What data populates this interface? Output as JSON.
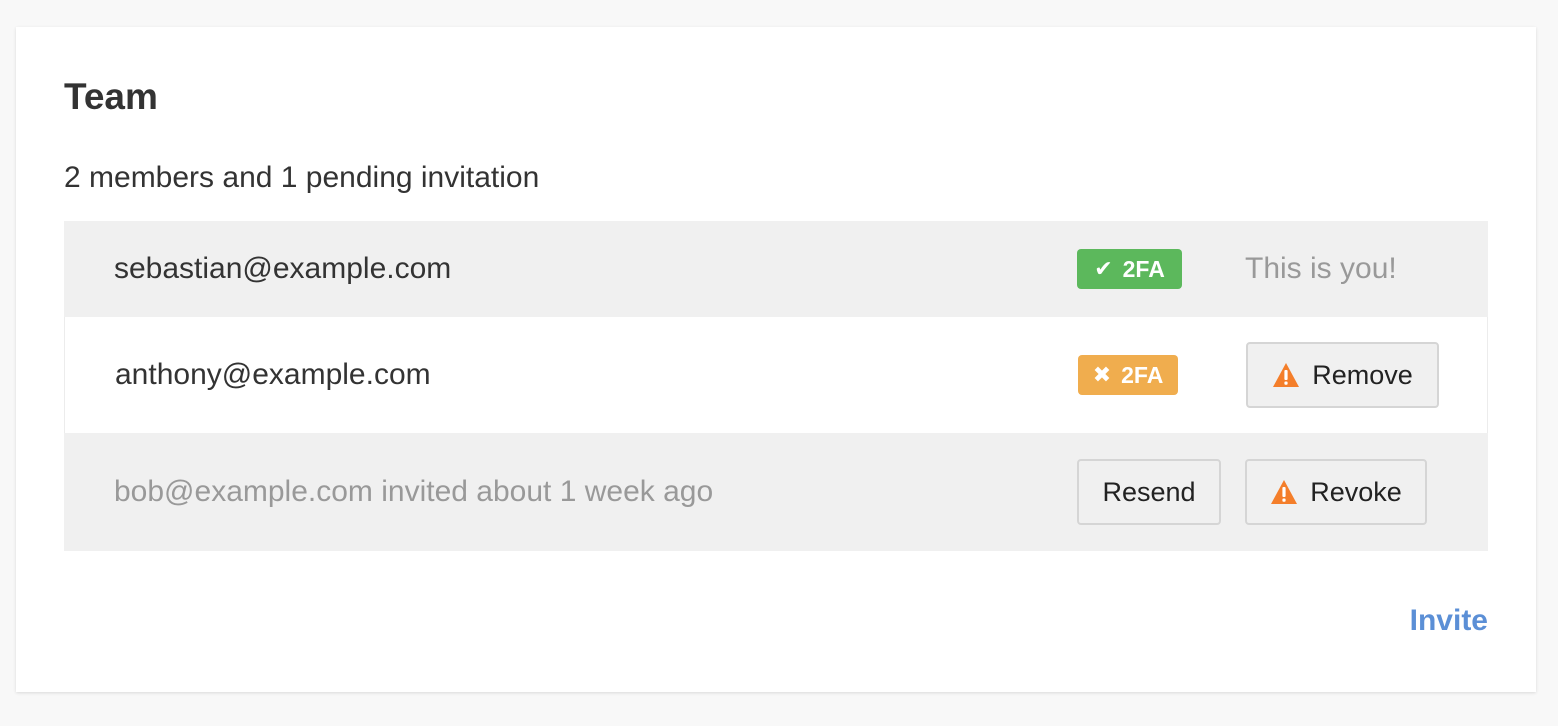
{
  "team": {
    "title": "Team",
    "summary": "2 members and 1 pending invitation",
    "members": [
      {
        "email": "sebastian@example.com",
        "two_fa": {
          "label": "2FA",
          "enabled": true,
          "icon": "check-icon",
          "color": "#5cb85c"
        },
        "note": "This is you!"
      },
      {
        "email": "anthony@example.com",
        "two_fa": {
          "label": "2FA",
          "enabled": false,
          "icon": "x-icon",
          "color": "#f0ad4e"
        },
        "action_label": "Remove",
        "action_icon": "warning-icon"
      }
    ],
    "invitations": [
      {
        "text": "bob@example.com invited about 1 week ago",
        "resend_label": "Resend",
        "revoke_label": "Revoke",
        "revoke_icon": "warning-icon"
      }
    ],
    "invite_label": "Invite"
  },
  "colors": {
    "accent": "#5b8fd6",
    "warning_icon": "#f47e2a",
    "badge_ok": "#5cb85c",
    "badge_warn": "#f0ad4e"
  }
}
